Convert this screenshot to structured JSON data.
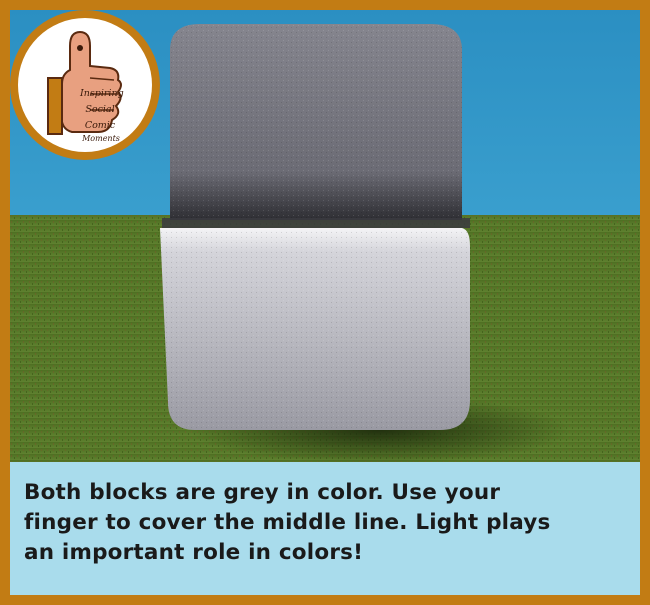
{
  "logo": {
    "lines": [
      "Inspiring",
      "Social",
      "Comic",
      "Moments"
    ]
  },
  "caption": {
    "line1": "Both blocks are grey in color. Use your",
    "line2": "finger to cover the middle line. Light plays",
    "line3": "an important role in colors!"
  },
  "colors": {
    "frame": "#c27c14",
    "sky": "#2f8fc0",
    "grass": "#5a7a2a",
    "caption_bg": "#a9dcec",
    "block_top": "#6b6b75",
    "block_bottom": "#cfcfd6"
  }
}
